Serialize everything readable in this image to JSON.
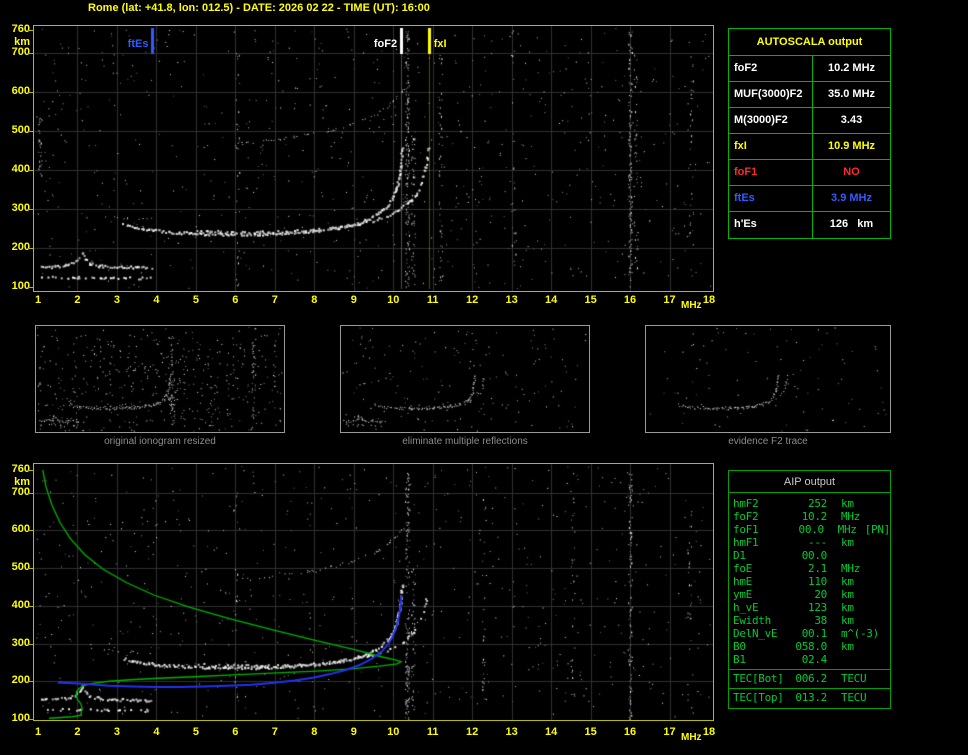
{
  "header": {
    "title": "Rome (lat: +41.8, lon: 012.5) - DATE: 2026 02 22 - TIME (UT): 16:00"
  },
  "autoscala": {
    "title": "AUTOSCALA output",
    "rows": [
      {
        "label": "foF2",
        "value": "10.2 MHz",
        "color": "#ffffff"
      },
      {
        "label": "MUF(3000)F2",
        "value": "35.0 MHz",
        "color": "#ffffff"
      },
      {
        "label": "M(3000)F2",
        "value": "3.43",
        "color": "#ffffff"
      },
      {
        "label": "fxI",
        "value": "10.9 MHz",
        "color": "#ffff00"
      },
      {
        "label": "foF1",
        "value": "NO",
        "color": "#ff2a2a"
      },
      {
        "label": "ftEs",
        "value": "3.9 MHz",
        "color": "#2e5cff"
      },
      {
        "label": "h'Es",
        "value": "126   km",
        "color": "#ffffff"
      }
    ]
  },
  "aip": {
    "title": "AIP output",
    "rows": [
      {
        "name": "hmF2",
        "value": "252",
        "unit": "km",
        "tag": "",
        "sep": false
      },
      {
        "name": "foF2",
        "value": "10.2",
        "unit": "MHz",
        "tag": "",
        "sep": false
      },
      {
        "name": "foF1",
        "value": "00.0",
        "unit": "MHz",
        "tag": "[PN]",
        "sep": false
      },
      {
        "name": "hmF1",
        "value": "---",
        "unit": "km",
        "tag": "",
        "sep": false
      },
      {
        "name": "D1",
        "value": "00.0",
        "unit": "",
        "tag": "",
        "sep": false
      },
      {
        "name": "foE",
        "value": "2.1",
        "unit": "MHz",
        "tag": "",
        "sep": false
      },
      {
        "name": "hmE",
        "value": "110",
        "unit": "km",
        "tag": "",
        "sep": false
      },
      {
        "name": "ymE",
        "value": "20",
        "unit": "km",
        "tag": "",
        "sep": false
      },
      {
        "name": "h_vE",
        "value": "123",
        "unit": "km",
        "tag": "",
        "sep": false
      },
      {
        "name": "Ewidth",
        "value": "38",
        "unit": "km",
        "tag": "",
        "sep": false
      },
      {
        "name": "DelN_vE",
        "value": "00.1",
        "unit": "m^(-3)",
        "tag": "",
        "sep": false
      },
      {
        "name": "B0",
        "value": "058.0",
        "unit": "km",
        "tag": "",
        "sep": false
      },
      {
        "name": "B1",
        "value": "02.4",
        "unit": "",
        "tag": "",
        "sep": false
      },
      {
        "name": "TEC[Bot]",
        "value": "006.2",
        "unit": "TECU",
        "tag": "",
        "sep": true
      },
      {
        "name": "TEC[Top]",
        "value": "013.2",
        "unit": "TECU",
        "tag": "",
        "sep": true
      }
    ]
  },
  "thumbnails": {
    "items": [
      {
        "caption": "original ionogram resized",
        "trace_indices": [
          0,
          1,
          2,
          3,
          4,
          5
        ],
        "noise_count": 420,
        "rfi": true,
        "seed": 21
      },
      {
        "caption": "eliminate multiple reflections",
        "trace_indices": [
          0,
          1,
          3,
          4
        ],
        "noise_count": 170,
        "rfi": false,
        "seed": 22
      },
      {
        "caption": "evidence F2 trace",
        "trace_indices": [
          3,
          4
        ],
        "noise_count": 90,
        "rfi": false,
        "seed": 23
      }
    ]
  },
  "chart_data": [
    {
      "id": "ionogram_main",
      "type": "scatter",
      "title": "",
      "xlabel": "MHz",
      "ylabel": "km",
      "xlim": [
        1,
        18
      ],
      "ylim": [
        100,
        760
      ],
      "x_ticks": [
        1,
        2,
        3,
        4,
        5,
        6,
        7,
        8,
        9,
        10,
        11,
        12,
        13,
        14,
        15,
        16,
        17,
        18
      ],
      "y_ticks": [
        760,
        700,
        600,
        500,
        400,
        300,
        200,
        100
      ],
      "grid": true,
      "legend": "none",
      "markers": [
        {
          "label": "ftEs",
          "x": 3.9,
          "color": "#2e5cff",
          "side": "left",
          "full_line": false
        },
        {
          "label": "foF2",
          "x": 10.2,
          "color": "#ffffff",
          "side": "left",
          "full_line": true
        },
        {
          "label": "fxI",
          "x": 10.9,
          "color": "#ffff00",
          "side": "right",
          "full_line": true
        }
      ],
      "traces": [
        {
          "name": "Es",
          "color": "#ffffff",
          "density": 0.38,
          "size": 2,
          "points": [
            [
              1.1,
              128
            ],
            [
              2.0,
              126
            ],
            [
              3.0,
              125
            ],
            [
              3.9,
              124
            ]
          ]
        },
        {
          "name": "E",
          "color": "#ffffff",
          "density": 0.8,
          "size": 2,
          "points": [
            [
              1.05,
              152
            ],
            [
              1.4,
              154
            ],
            [
              1.7,
              157
            ],
            [
              1.95,
              166
            ],
            [
              2.05,
              178
            ],
            [
              2.1,
              190
            ],
            [
              2.18,
              176
            ],
            [
              2.3,
              162
            ],
            [
              2.55,
              156
            ],
            [
              3.0,
              153
            ],
            [
              3.5,
              152
            ],
            [
              3.85,
              151
            ]
          ]
        },
        {
          "name": "Es_hop2",
          "color": "#dddddd",
          "density": 0.22,
          "size": 1,
          "points": [
            [
              2.35,
              286
            ],
            [
              3.1,
              280
            ],
            [
              3.9,
              276
            ]
          ]
        },
        {
          "name": "F2_O",
          "color": "#ffffff",
          "density": 0.92,
          "size": 2,
          "points": [
            [
              3.15,
              262
            ],
            [
              3.5,
              253
            ],
            [
              3.9,
              247
            ],
            [
              4.3,
              243
            ],
            [
              4.8,
              240
            ],
            [
              5.3,
              238
            ],
            [
              5.8,
              237
            ],
            [
              6.3,
              237
            ],
            [
              6.8,
              238
            ],
            [
              7.3,
              240
            ],
            [
              7.7,
              243
            ],
            [
              8.1,
              247
            ],
            [
              8.45,
              252
            ],
            [
              8.8,
              258
            ],
            [
              9.1,
              266
            ],
            [
              9.35,
              275
            ],
            [
              9.55,
              286
            ],
            [
              9.72,
              298
            ],
            [
              9.85,
              312
            ],
            [
              9.95,
              328
            ],
            [
              10.04,
              346
            ],
            [
              10.1,
              366
            ],
            [
              10.15,
              390
            ],
            [
              10.18,
              414
            ],
            [
              10.2,
              440
            ],
            [
              10.21,
              458
            ]
          ]
        },
        {
          "name": "F2_X",
          "color": "#e8e8e8",
          "density": 0.5,
          "size": 2,
          "points": [
            [
              4.9,
              247
            ],
            [
              5.7,
              243
            ],
            [
              6.5,
              242
            ],
            [
              7.3,
              244
            ],
            [
              8.0,
              248
            ],
            [
              8.6,
              254
            ],
            [
              9.1,
              262
            ],
            [
              9.5,
              272
            ],
            [
              9.85,
              284
            ],
            [
              10.15,
              300
            ],
            [
              10.4,
              320
            ],
            [
              10.58,
              344
            ],
            [
              10.7,
              370
            ],
            [
              10.78,
              398
            ],
            [
              10.84,
              428
            ],
            [
              10.88,
              455
            ]
          ]
        },
        {
          "name": "F2_hop2",
          "color": "#cccccc",
          "density": 0.4,
          "size": 1,
          "points": [
            [
              6.0,
              468
            ],
            [
              6.6,
              474
            ],
            [
              7.2,
              482
            ],
            [
              7.8,
              491
            ],
            [
              8.4,
              503
            ],
            [
              8.9,
              517
            ],
            [
              9.3,
              532
            ],
            [
              9.65,
              550
            ],
            [
              9.9,
              569
            ],
            [
              10.1,
              589
            ],
            [
              10.25,
              607
            ],
            [
              10.38,
              623
            ]
          ]
        }
      ],
      "noise": {
        "count": 750,
        "seed": 7
      },
      "rfi_columns": [
        {
          "x": 10.35,
          "h_range": [
            100,
            760
          ],
          "count": 150
        },
        {
          "x": 10.5,
          "h_range": [
            100,
            500
          ],
          "count": 55
        },
        {
          "x": 16.0,
          "h_range": [
            100,
            760
          ],
          "count": 120
        },
        {
          "x": 16.15,
          "h_range": [
            150,
            700
          ],
          "count": 40
        },
        {
          "x": 11.2,
          "h_range": [
            100,
            700
          ],
          "count": 45
        },
        {
          "x": 6.05,
          "h_range": [
            100,
            700
          ],
          "count": 28
        },
        {
          "x": 13.05,
          "h_range": [
            150,
            760
          ],
          "count": 26
        },
        {
          "x": 1.05,
          "h_range": [
            380,
            540
          ],
          "count": 26
        },
        {
          "x": 17.55,
          "h_range": [
            100,
            700
          ],
          "count": 30
        }
      ]
    },
    {
      "id": "ionogram_profile",
      "type": "scatter",
      "title": "",
      "xlabel": "MHz",
      "ylabel": "km",
      "xlim": [
        1,
        18
      ],
      "ylim": [
        100,
        760
      ],
      "x_ticks": [
        1,
        2,
        3,
        4,
        5,
        6,
        7,
        8,
        9,
        10,
        11,
        12,
        13,
        14,
        15,
        16,
        17,
        18
      ],
      "y_ticks": [
        760,
        700,
        600,
        500,
        400,
        300,
        200,
        100
      ],
      "grid": true,
      "legend": "none",
      "markers": [],
      "traces_from": 0,
      "profile": {
        "name": "electron density profile (green)",
        "color": "#00b400",
        "points": [
          [
            1.12,
            760
          ],
          [
            1.2,
            716
          ],
          [
            1.35,
            668
          ],
          [
            1.55,
            622
          ],
          [
            1.82,
            578
          ],
          [
            2.18,
            536
          ],
          [
            2.65,
            497
          ],
          [
            3.25,
            461
          ],
          [
            3.95,
            428
          ],
          [
            4.85,
            396
          ],
          [
            5.85,
            366
          ],
          [
            6.95,
            336
          ],
          [
            8.05,
            308
          ],
          [
            9.05,
            283
          ],
          [
            9.7,
            265
          ],
          [
            10.08,
            256
          ],
          [
            10.2,
            252
          ],
          [
            10.1,
            246
          ],
          [
            9.65,
            240
          ],
          [
            8.95,
            233
          ],
          [
            8.05,
            227
          ],
          [
            7.05,
            222
          ],
          [
            5.95,
            217
          ],
          [
            4.95,
            212
          ],
          [
            4.05,
            208
          ],
          [
            3.35,
            204
          ],
          [
            2.8,
            200
          ],
          [
            2.42,
            195
          ],
          [
            2.18,
            189
          ],
          [
            2.04,
            181
          ],
          [
            1.98,
            172
          ],
          [
            1.97,
            162
          ],
          [
            2.0,
            152
          ],
          [
            2.06,
            144
          ],
          [
            2.1,
            136
          ],
          [
            2.12,
            128
          ],
          [
            2.1,
            120
          ],
          [
            2.09,
            114
          ],
          [
            2.1,
            110
          ],
          [
            1.88,
            106
          ],
          [
            1.58,
            104
          ],
          [
            1.28,
            102
          ]
        ]
      },
      "restored_trace": {
        "name": "autoscaled trace (blue)",
        "color": "#2233ee",
        "points": [
          [
            1.5,
            197
          ],
          [
            1.9,
            195
          ],
          [
            2.3,
            192
          ],
          [
            2.8,
            188
          ],
          [
            3.4,
            186
          ],
          [
            4.0,
            185
          ],
          [
            4.6,
            185
          ],
          [
            5.2,
            186
          ],
          [
            5.8,
            188
          ],
          [
            6.4,
            191
          ],
          [
            7.0,
            196
          ],
          [
            7.5,
            202
          ],
          [
            8.0,
            210
          ],
          [
            8.4,
            219
          ],
          [
            8.8,
            230
          ],
          [
            9.15,
            243
          ],
          [
            9.45,
            259
          ],
          [
            9.7,
            278
          ],
          [
            9.88,
            299
          ],
          [
            10.0,
            322
          ],
          [
            10.09,
            347
          ],
          [
            10.15,
            374
          ],
          [
            10.19,
            402
          ],
          [
            10.21,
            428
          ]
        ]
      },
      "noise": {
        "count": 680,
        "seed": 13
      },
      "rfi_columns": [
        {
          "x": 10.35,
          "h_range": [
            100,
            760
          ],
          "count": 140
        },
        {
          "x": 10.5,
          "h_range": [
            100,
            500
          ],
          "count": 45
        },
        {
          "x": 16.0,
          "h_range": [
            100,
            760
          ],
          "count": 100
        },
        {
          "x": 14.55,
          "h_range": [
            150,
            700
          ],
          "count": 30
        },
        {
          "x": 6.0,
          "h_range": [
            150,
            700
          ],
          "count": 24
        },
        {
          "x": 17.5,
          "h_range": [
            100,
            650
          ],
          "count": 26
        },
        {
          "x": 12.3,
          "h_range": [
            150,
            700
          ],
          "count": 22
        }
      ]
    }
  ]
}
